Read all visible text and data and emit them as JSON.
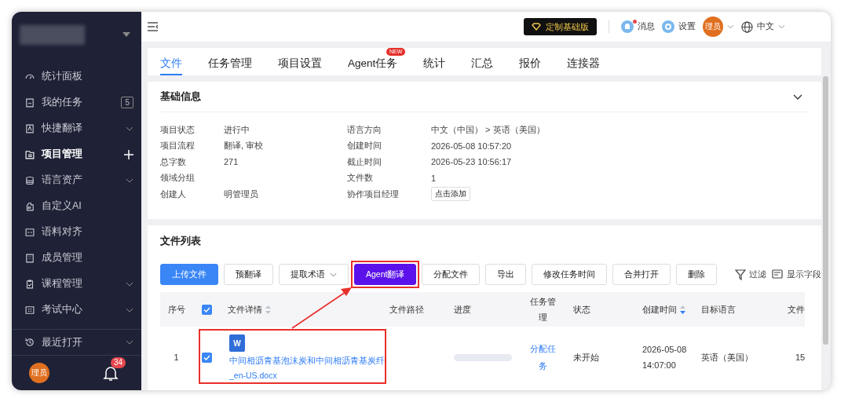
{
  "sidebar": {
    "items": [
      {
        "label": "统计面板",
        "selected": false,
        "kind": "plain"
      },
      {
        "label": "我的任务",
        "selected": false,
        "kind": "count",
        "count": "5"
      },
      {
        "label": "快捷翻译",
        "selected": false,
        "kind": "submenu"
      },
      {
        "label": "项目管理",
        "selected": true,
        "kind": "add"
      },
      {
        "label": "语言资产",
        "selected": false,
        "kind": "submenu"
      },
      {
        "label": "自定义AI",
        "selected": false,
        "kind": "plain"
      },
      {
        "label": "语料对齐",
        "selected": false,
        "kind": "plain"
      },
      {
        "label": "成员管理",
        "selected": false,
        "kind": "plain"
      },
      {
        "label": "课程管理",
        "selected": false,
        "kind": "submenu"
      },
      {
        "label": "考试中心",
        "selected": false,
        "kind": "submenu"
      }
    ],
    "recent": {
      "label": "最近打开"
    },
    "user": {
      "avatar": "理员"
    },
    "notifications": {
      "count": "34"
    }
  },
  "topbar": {
    "plan": "定制基础版",
    "messages": {
      "label": "消息",
      "unread": true
    },
    "settings": "设置",
    "avatar": "理员",
    "language": "中文"
  },
  "tabs": [
    {
      "label": "文件",
      "selected": true
    },
    {
      "label": "任务管理",
      "selected": false
    },
    {
      "label": "项目设置",
      "selected": false
    },
    {
      "label": "Agent任务",
      "selected": false,
      "badge": "NEW"
    },
    {
      "label": "统计",
      "selected": false
    },
    {
      "label": "汇总",
      "selected": false
    },
    {
      "label": "报价",
      "selected": false
    },
    {
      "label": "连接器",
      "selected": false
    }
  ],
  "basic_info": {
    "title": "基础信息",
    "rows": [
      [
        {
          "label": "项目状态",
          "value": "进行中"
        },
        {
          "label": "语言方向",
          "value": "中文（中国） > 英语（美国）"
        }
      ],
      [
        {
          "label": "项目流程",
          "value": "翻译, 审校"
        },
        {
          "label": "创建时间",
          "value": "2026-05-08 10:57:20"
        }
      ],
      [
        {
          "label": "总字数",
          "value": "271"
        },
        {
          "label": "截止时间",
          "value": "2026-05-23 10:56:17"
        }
      ],
      [
        {
          "label": "领域分组"
        },
        {
          "label": "文件数",
          "value": "1"
        }
      ],
      [
        {
          "label": "创建人",
          "value": "明管理员"
        },
        {
          "label": "协作项目经理",
          "button": "点击添加"
        }
      ]
    ]
  },
  "file_list": {
    "title": "文件列表",
    "toolbar": [
      {
        "label": "上传文件",
        "kind": "primary"
      },
      {
        "label": "预翻译",
        "kind": "default"
      },
      {
        "label": "提取术语",
        "kind": "dropdown"
      },
      {
        "label": "Agent翻译",
        "kind": "agent"
      },
      {
        "label": "分配文件",
        "kind": "default"
      },
      {
        "label": "导出",
        "kind": "default"
      },
      {
        "label": "修改任务时间",
        "kind": "default"
      },
      {
        "label": "合并打开",
        "kind": "default"
      },
      {
        "label": "删除",
        "kind": "default"
      }
    ],
    "filter": "过滤",
    "fields": "显示字段",
    "table": {
      "columns": [
        {
          "label": "序号"
        },
        {
          "kind": "checkbox",
          "checked": true
        },
        {
          "label": "文件详情",
          "sortable": true,
          "sorted_desc": false
        },
        {
          "label": "文件路径"
        },
        {
          "label": "进度"
        },
        {
          "label": "任务管理"
        },
        {
          "label": "状态"
        },
        {
          "label": "创建时间",
          "sortable": true,
          "sorted_desc": true
        },
        {
          "label": "目标语言"
        },
        {
          "label": "文件"
        }
      ],
      "rows": [
        {
          "index": "1",
          "checked": true,
          "file_name": "中间相沥青基泡沫炭和中间相沥青基炭纤",
          "file_suffix": "_en-US.docx",
          "file_icon": "W",
          "level": 0,
          "action": "分配任务",
          "status": "未开始",
          "created": "2026-05-08 14:07:00",
          "target": "英语（美国）",
          "column_10": "15"
        }
      ]
    }
  }
}
